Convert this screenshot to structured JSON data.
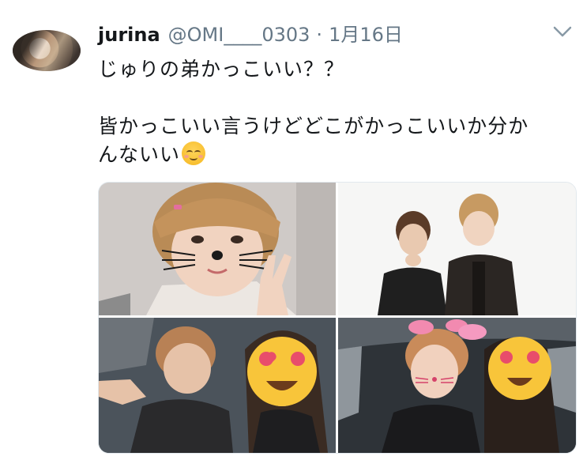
{
  "tweet": {
    "display_name": "jurina",
    "handle": "@OMI____0303",
    "separator": "·",
    "date": "1月16日",
    "lines": [
      "じゅりの弟かっこいい？？",
      "皆かっこいい言うけどどこがかっこいいか分か",
      "んないい"
    ]
  },
  "icons": {
    "caret": "chevron-down-icon",
    "emoji": "relieved-face-emoji"
  },
  "colors": {
    "text": "#14171a",
    "muted": "#657786",
    "border": "#e1e8ed"
  }
}
